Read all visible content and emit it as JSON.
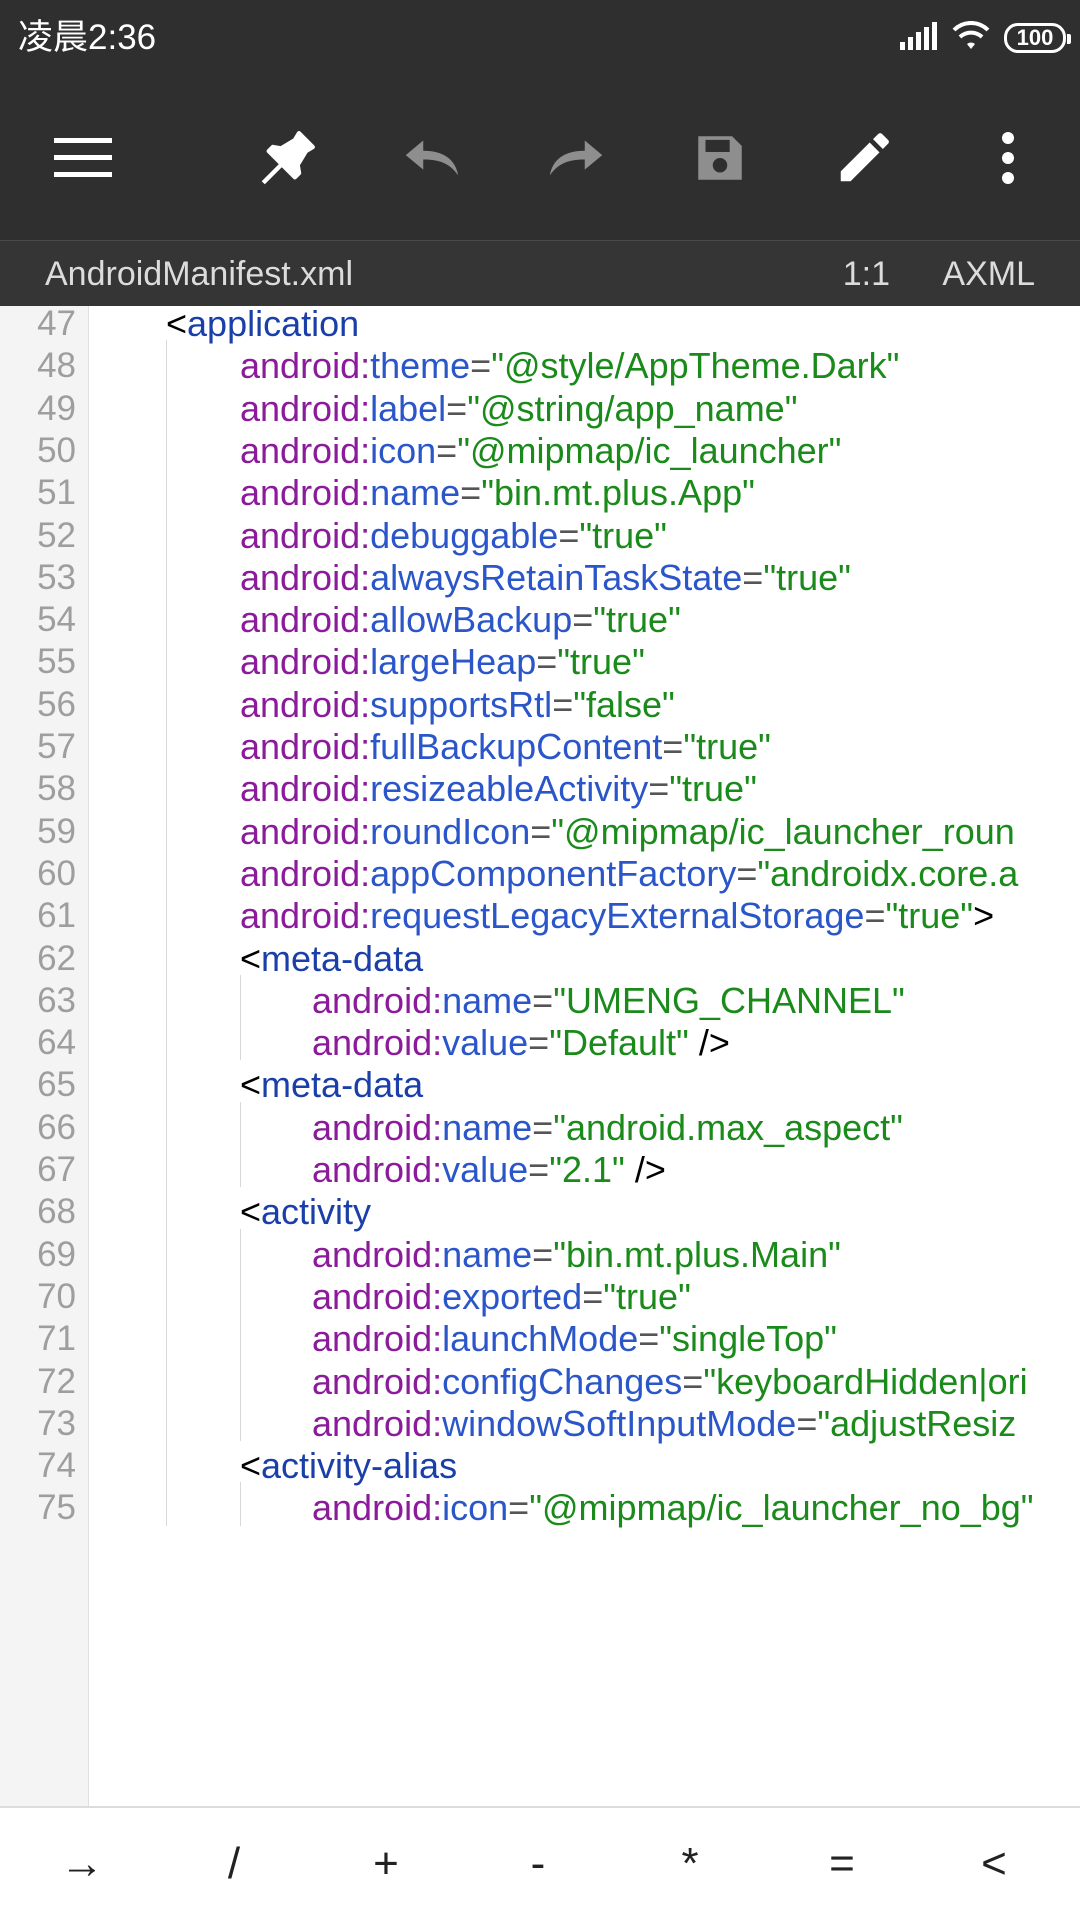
{
  "status_bar": {
    "time": "凌晨2:36",
    "battery": "100",
    "icons": [
      "signal-icon",
      "wifi-icon",
      "battery-icon"
    ]
  },
  "toolbar": {
    "buttons": [
      {
        "name": "menu-icon"
      },
      {
        "name": "pin-icon"
      },
      {
        "name": "undo-icon"
      },
      {
        "name": "redo-icon"
      },
      {
        "name": "save-icon"
      },
      {
        "name": "edit-icon"
      },
      {
        "name": "more-icon"
      }
    ]
  },
  "file_bar": {
    "file_name": "AndroidManifest.xml",
    "cursor_position": "1:1",
    "file_type": "AXML"
  },
  "editor": {
    "lines": [
      {
        "number": "47",
        "indent": 1,
        "parts": [
          [
            "br",
            "<"
          ],
          [
            "tag",
            "application"
          ]
        ]
      },
      {
        "number": "48",
        "indent": 2,
        "parts": [
          [
            "ns",
            "android:"
          ],
          [
            "attr",
            "theme"
          ],
          [
            "eq",
            "="
          ],
          [
            "val",
            "\"@style/AppTheme.Dark\""
          ]
        ]
      },
      {
        "number": "49",
        "indent": 2,
        "parts": [
          [
            "ns",
            "android:"
          ],
          [
            "attr",
            "label"
          ],
          [
            "eq",
            "="
          ],
          [
            "val",
            "\"@string/app_name\""
          ]
        ]
      },
      {
        "number": "50",
        "indent": 2,
        "parts": [
          [
            "ns",
            "android:"
          ],
          [
            "attr",
            "icon"
          ],
          [
            "eq",
            "="
          ],
          [
            "val",
            "\"@mipmap/ic_launcher\""
          ]
        ]
      },
      {
        "number": "51",
        "indent": 2,
        "parts": [
          [
            "ns",
            "android:"
          ],
          [
            "attr",
            "name"
          ],
          [
            "eq",
            "="
          ],
          [
            "val",
            "\"bin.mt.plus.App\""
          ]
        ]
      },
      {
        "number": "52",
        "indent": 2,
        "parts": [
          [
            "ns",
            "android:"
          ],
          [
            "attr",
            "debuggable"
          ],
          [
            "eq",
            "="
          ],
          [
            "val",
            "\"true\""
          ]
        ]
      },
      {
        "number": "53",
        "indent": 2,
        "parts": [
          [
            "ns",
            "android:"
          ],
          [
            "attr",
            "alwaysRetainTaskState"
          ],
          [
            "eq",
            "="
          ],
          [
            "val",
            "\"true\""
          ]
        ]
      },
      {
        "number": "54",
        "indent": 2,
        "parts": [
          [
            "ns",
            "android:"
          ],
          [
            "attr",
            "allowBackup"
          ],
          [
            "eq",
            "="
          ],
          [
            "val",
            "\"true\""
          ]
        ]
      },
      {
        "number": "55",
        "indent": 2,
        "parts": [
          [
            "ns",
            "android:"
          ],
          [
            "attr",
            "largeHeap"
          ],
          [
            "eq",
            "="
          ],
          [
            "val",
            "\"true\""
          ]
        ]
      },
      {
        "number": "56",
        "indent": 2,
        "parts": [
          [
            "ns",
            "android:"
          ],
          [
            "attr",
            "supportsRtl"
          ],
          [
            "eq",
            "="
          ],
          [
            "val",
            "\"false\""
          ]
        ]
      },
      {
        "number": "57",
        "indent": 2,
        "parts": [
          [
            "ns",
            "android:"
          ],
          [
            "attr",
            "fullBackupContent"
          ],
          [
            "eq",
            "="
          ],
          [
            "val",
            "\"true\""
          ]
        ]
      },
      {
        "number": "58",
        "indent": 2,
        "parts": [
          [
            "ns",
            "android:"
          ],
          [
            "attr",
            "resizeableActivity"
          ],
          [
            "eq",
            "="
          ],
          [
            "val",
            "\"true\""
          ]
        ]
      },
      {
        "number": "59",
        "indent": 2,
        "parts": [
          [
            "ns",
            "android:"
          ],
          [
            "attr",
            "roundIcon"
          ],
          [
            "eq",
            "="
          ],
          [
            "val",
            "\"@mipmap/ic_launcher_roun"
          ]
        ]
      },
      {
        "number": "60",
        "indent": 2,
        "parts": [
          [
            "ns",
            "android:"
          ],
          [
            "attr",
            "appComponentFactory"
          ],
          [
            "eq",
            "="
          ],
          [
            "val",
            "\"androidx.core.a"
          ]
        ]
      },
      {
        "number": "61",
        "indent": 2,
        "parts": [
          [
            "ns",
            "android:"
          ],
          [
            "attr",
            "requestLegacyExternalStorage"
          ],
          [
            "eq",
            "="
          ],
          [
            "val",
            "\"true\""
          ],
          [
            "br",
            ">"
          ]
        ]
      },
      {
        "number": "62",
        "indent": 2,
        "parts": [
          [
            "br",
            "<"
          ],
          [
            "tag",
            "meta-data"
          ]
        ]
      },
      {
        "number": "63",
        "indent": 3,
        "parts": [
          [
            "ns",
            "android:"
          ],
          [
            "attr",
            "name"
          ],
          [
            "eq",
            "="
          ],
          [
            "val",
            "\"UMENG_CHANNEL\""
          ]
        ]
      },
      {
        "number": "64",
        "indent": 3,
        "parts": [
          [
            "ns",
            "android:"
          ],
          [
            "attr",
            "value"
          ],
          [
            "eq",
            "="
          ],
          [
            "val",
            "\"Default\""
          ],
          [
            "br",
            "  />"
          ]
        ]
      },
      {
        "number": "65",
        "indent": 2,
        "parts": [
          [
            "br",
            "<"
          ],
          [
            "tag",
            "meta-data"
          ]
        ]
      },
      {
        "number": "66",
        "indent": 3,
        "parts": [
          [
            "ns",
            "android:"
          ],
          [
            "attr",
            "name"
          ],
          [
            "eq",
            "="
          ],
          [
            "val",
            "\"android.max_aspect\""
          ]
        ]
      },
      {
        "number": "67",
        "indent": 3,
        "parts": [
          [
            "ns",
            "android:"
          ],
          [
            "attr",
            "value"
          ],
          [
            "eq",
            "="
          ],
          [
            "val",
            "\"2.1\""
          ],
          [
            "br",
            "  />"
          ]
        ]
      },
      {
        "number": "68",
        "indent": 2,
        "parts": [
          [
            "br",
            "<"
          ],
          [
            "tag",
            "activity"
          ]
        ]
      },
      {
        "number": "69",
        "indent": 3,
        "parts": [
          [
            "ns",
            "android:"
          ],
          [
            "attr",
            "name"
          ],
          [
            "eq",
            "="
          ],
          [
            "val",
            "\"bin.mt.plus.Main\""
          ]
        ]
      },
      {
        "number": "70",
        "indent": 3,
        "parts": [
          [
            "ns",
            "android:"
          ],
          [
            "attr",
            "exported"
          ],
          [
            "eq",
            "="
          ],
          [
            "val",
            "\"true\""
          ]
        ]
      },
      {
        "number": "71",
        "indent": 3,
        "parts": [
          [
            "ns",
            "android:"
          ],
          [
            "attr",
            "launchMode"
          ],
          [
            "eq",
            "="
          ],
          [
            "val",
            "\"singleTop\""
          ]
        ]
      },
      {
        "number": "72",
        "indent": 3,
        "parts": [
          [
            "ns",
            "android:"
          ],
          [
            "attr",
            "configChanges"
          ],
          [
            "eq",
            "="
          ],
          [
            "val",
            "\"keyboardHidden|ori"
          ]
        ]
      },
      {
        "number": "73",
        "indent": 3,
        "parts": [
          [
            "ns",
            "android:"
          ],
          [
            "attr",
            "windowSoftInputMode"
          ],
          [
            "eq",
            "="
          ],
          [
            "val",
            "\"adjustResiz"
          ]
        ]
      },
      {
        "number": "74",
        "indent": 2,
        "parts": [
          [
            "br",
            "<"
          ],
          [
            "tag",
            "activity-alias"
          ]
        ]
      },
      {
        "number": "75",
        "indent": 3,
        "parts": [
          [
            "ns",
            "android:"
          ],
          [
            "attr",
            "icon"
          ],
          [
            "eq",
            "="
          ],
          [
            "val",
            "\"@mipmap/ic_launcher_no_bg\""
          ]
        ]
      }
    ]
  },
  "keybar": {
    "keys": [
      "→",
      "/",
      "+",
      "-",
      "*",
      "=",
      "<"
    ]
  }
}
